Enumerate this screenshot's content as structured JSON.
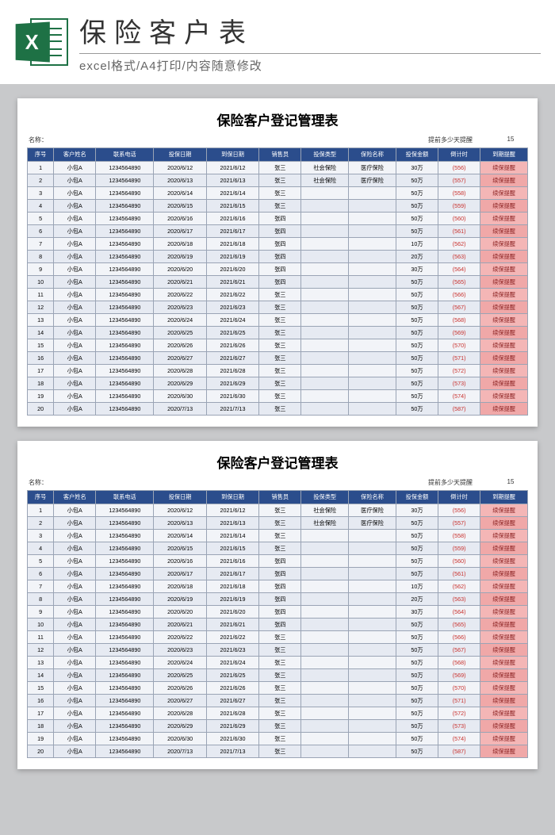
{
  "header": {
    "title": "保险客户表",
    "subtitle": "excel格式/A4打印/内容随意修改",
    "icon_letter": "X"
  },
  "sheet": {
    "title": "保险客户登记管理表",
    "meta_name_label": "名称：",
    "meta_remind_label": "提前多少天提醒",
    "meta_remind_value": "15",
    "columns": [
      "序号",
      "客户姓名",
      "联系电话",
      "投保日期",
      "到保日期",
      "销售员",
      "投保类型",
      "保险名称",
      "投保金额",
      "倒计时",
      "到期提醒"
    ],
    "rows": [
      {
        "seq": "1",
        "name": "小包A",
        "phone": "1234564890",
        "d1": "2020/6/12",
        "d2": "2021/6/12",
        "sales": "张三",
        "type": "社会保险",
        "ins": "医疗保险",
        "amt": "30万",
        "cd": "(556)",
        "alert": "续保提醒"
      },
      {
        "seq": "2",
        "name": "小包A",
        "phone": "1234564890",
        "d1": "2020/6/13",
        "d2": "2021/6/13",
        "sales": "张三",
        "type": "社会保险",
        "ins": "医疗保险",
        "amt": "50万",
        "cd": "(557)",
        "alert": "续保提醒"
      },
      {
        "seq": "3",
        "name": "小包A",
        "phone": "1234564890",
        "d1": "2020/6/14",
        "d2": "2021/6/14",
        "sales": "张三",
        "type": "",
        "ins": "",
        "amt": "50万",
        "cd": "(558)",
        "alert": "续保提醒"
      },
      {
        "seq": "4",
        "name": "小包A",
        "phone": "1234564890",
        "d1": "2020/6/15",
        "d2": "2021/6/15",
        "sales": "张三",
        "type": "",
        "ins": "",
        "amt": "50万",
        "cd": "(559)",
        "alert": "续保提醒"
      },
      {
        "seq": "5",
        "name": "小包A",
        "phone": "1234564890",
        "d1": "2020/6/16",
        "d2": "2021/6/16",
        "sales": "张四",
        "type": "",
        "ins": "",
        "amt": "50万",
        "cd": "(560)",
        "alert": "续保提醒"
      },
      {
        "seq": "6",
        "name": "小包A",
        "phone": "1234564890",
        "d1": "2020/6/17",
        "d2": "2021/6/17",
        "sales": "张四",
        "type": "",
        "ins": "",
        "amt": "50万",
        "cd": "(561)",
        "alert": "续保提醒"
      },
      {
        "seq": "7",
        "name": "小包A",
        "phone": "1234564890",
        "d1": "2020/6/18",
        "d2": "2021/6/18",
        "sales": "张四",
        "type": "",
        "ins": "",
        "amt": "10万",
        "cd": "(562)",
        "alert": "续保提醒"
      },
      {
        "seq": "8",
        "name": "小包A",
        "phone": "1234564890",
        "d1": "2020/6/19",
        "d2": "2021/6/19",
        "sales": "张四",
        "type": "",
        "ins": "",
        "amt": "20万",
        "cd": "(563)",
        "alert": "续保提醒"
      },
      {
        "seq": "9",
        "name": "小包A",
        "phone": "1234564890",
        "d1": "2020/6/20",
        "d2": "2021/6/20",
        "sales": "张四",
        "type": "",
        "ins": "",
        "amt": "30万",
        "cd": "(564)",
        "alert": "续保提醒"
      },
      {
        "seq": "10",
        "name": "小包A",
        "phone": "1234564890",
        "d1": "2020/6/21",
        "d2": "2021/6/21",
        "sales": "张四",
        "type": "",
        "ins": "",
        "amt": "50万",
        "cd": "(565)",
        "alert": "续保提醒"
      },
      {
        "seq": "11",
        "name": "小包A",
        "phone": "1234564890",
        "d1": "2020/6/22",
        "d2": "2021/6/22",
        "sales": "张三",
        "type": "",
        "ins": "",
        "amt": "50万",
        "cd": "(566)",
        "alert": "续保提醒"
      },
      {
        "seq": "12",
        "name": "小包A",
        "phone": "1234564890",
        "d1": "2020/6/23",
        "d2": "2021/6/23",
        "sales": "张三",
        "type": "",
        "ins": "",
        "amt": "50万",
        "cd": "(567)",
        "alert": "续保提醒"
      },
      {
        "seq": "13",
        "name": "小包A",
        "phone": "1234564890",
        "d1": "2020/6/24",
        "d2": "2021/6/24",
        "sales": "张三",
        "type": "",
        "ins": "",
        "amt": "50万",
        "cd": "(568)",
        "alert": "续保提醒"
      },
      {
        "seq": "14",
        "name": "小包A",
        "phone": "1234564890",
        "d1": "2020/6/25",
        "d2": "2021/6/25",
        "sales": "张三",
        "type": "",
        "ins": "",
        "amt": "50万",
        "cd": "(569)",
        "alert": "续保提醒"
      },
      {
        "seq": "15",
        "name": "小包A",
        "phone": "1234564890",
        "d1": "2020/6/26",
        "d2": "2021/6/26",
        "sales": "张三",
        "type": "",
        "ins": "",
        "amt": "50万",
        "cd": "(570)",
        "alert": "续保提醒"
      },
      {
        "seq": "16",
        "name": "小包A",
        "phone": "1234564890",
        "d1": "2020/6/27",
        "d2": "2021/6/27",
        "sales": "张三",
        "type": "",
        "ins": "",
        "amt": "50万",
        "cd": "(571)",
        "alert": "续保提醒"
      },
      {
        "seq": "17",
        "name": "小包A",
        "phone": "1234564890",
        "d1": "2020/6/28",
        "d2": "2021/6/28",
        "sales": "张三",
        "type": "",
        "ins": "",
        "amt": "50万",
        "cd": "(572)",
        "alert": "续保提醒"
      },
      {
        "seq": "18",
        "name": "小包A",
        "phone": "1234564890",
        "d1": "2020/6/29",
        "d2": "2021/6/29",
        "sales": "张三",
        "type": "",
        "ins": "",
        "amt": "50万",
        "cd": "(573)",
        "alert": "续保提醒"
      },
      {
        "seq": "19",
        "name": "小包A",
        "phone": "1234564890",
        "d1": "2020/6/30",
        "d2": "2021/6/30",
        "sales": "张三",
        "type": "",
        "ins": "",
        "amt": "50万",
        "cd": "(574)",
        "alert": "续保提醒"
      },
      {
        "seq": "20",
        "name": "小包A",
        "phone": "1234564890",
        "d1": "2020/7/13",
        "d2": "2021/7/13",
        "sales": "张三",
        "type": "",
        "ins": "",
        "amt": "50万",
        "cd": "(587)",
        "alert": "续保提醒"
      }
    ]
  }
}
